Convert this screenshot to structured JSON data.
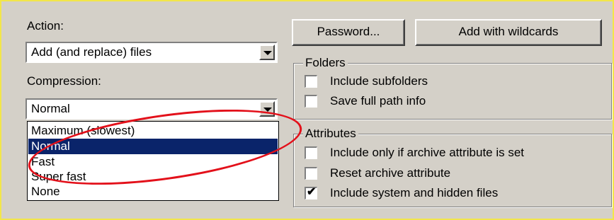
{
  "action": {
    "label": "Action:",
    "value": "Add (and replace) files"
  },
  "compression": {
    "label": "Compression:",
    "value": "Normal",
    "options": [
      "Maximum (slowest)",
      "Normal",
      "Fast",
      "Super fast",
      "None"
    ],
    "selected": "Normal"
  },
  "buttons": {
    "password": "Password...",
    "add_wildcards": "Add with wildcards"
  },
  "folders": {
    "title": "Folders",
    "include_subfolders": "Include subfolders",
    "save_full_path": "Save full path info"
  },
  "attributes": {
    "title": "Attributes",
    "only_archive_attr": "Include only if archive attribute is set",
    "reset_archive": "Reset archive attribute",
    "include_system_hidden": "Include system and hidden files"
  },
  "checkbox_states": {
    "include_subfolders": false,
    "save_full_path": false,
    "only_archive_attr": false,
    "reset_archive": false,
    "include_system_hidden": true
  },
  "annotation_color": "#e3101a",
  "highlight_color": "#0a246a"
}
